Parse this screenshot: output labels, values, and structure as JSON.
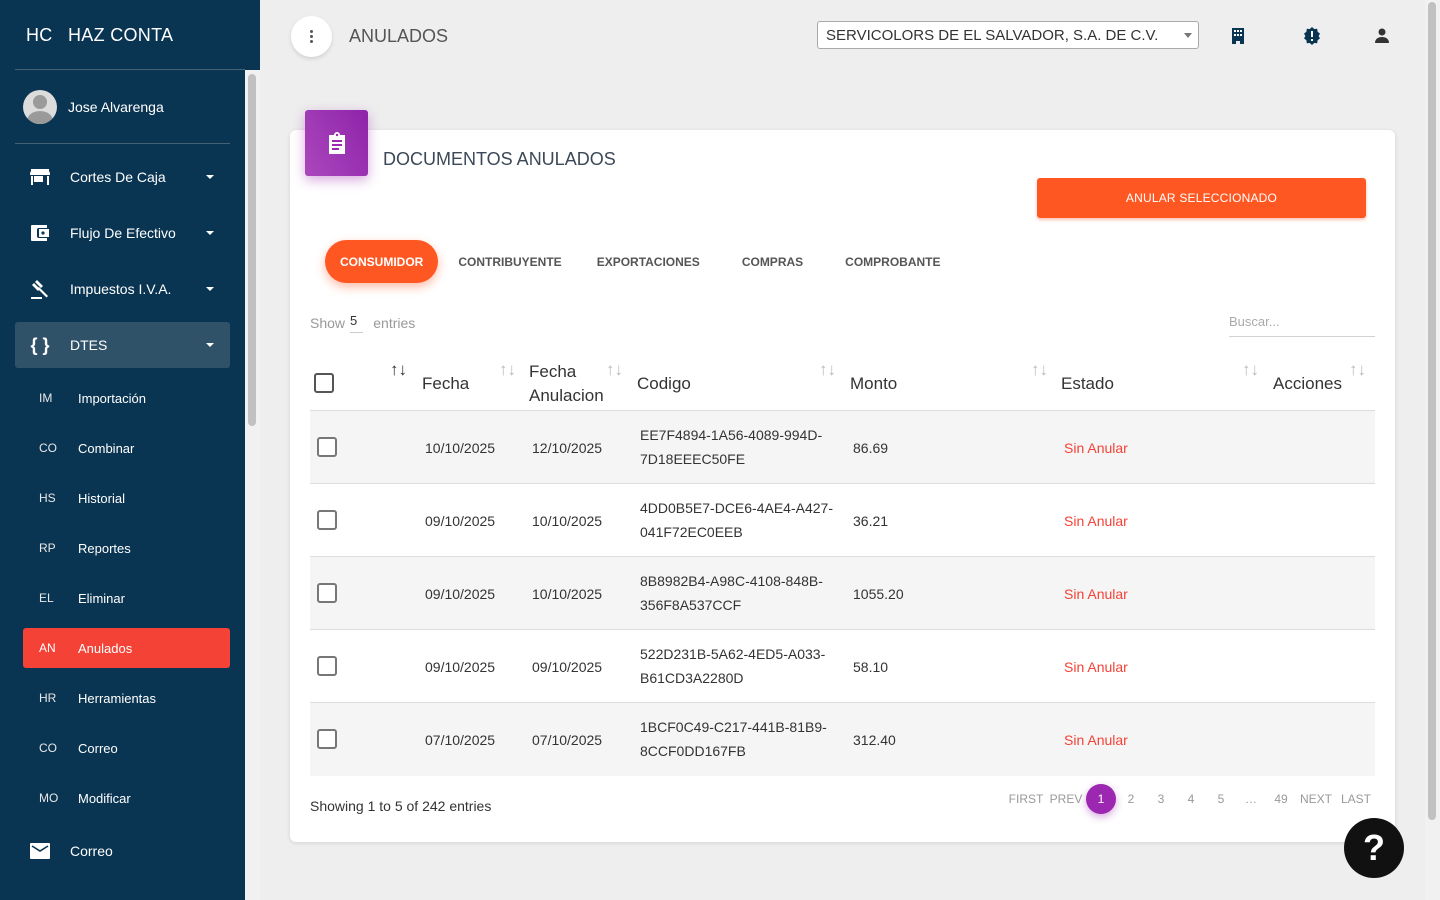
{
  "brand": {
    "mini": "HC",
    "name": "HAZ CONTA"
  },
  "user": {
    "name": "Jose Alvarenga"
  },
  "nav": [
    {
      "label": "Cortes De Caja",
      "icon": "store-icon"
    },
    {
      "label": "Flujo De Efectivo",
      "icon": "wallet-icon"
    },
    {
      "label": "Impuestos I.V.A.",
      "icon": "gavel-icon"
    },
    {
      "label": "DTES",
      "icon": "code-braces-icon"
    }
  ],
  "dtes_items": [
    {
      "abbr": "IM",
      "label": "Importación"
    },
    {
      "abbr": "CO",
      "label": "Combinar"
    },
    {
      "abbr": "HS",
      "label": "Historial"
    },
    {
      "abbr": "RP",
      "label": "Reportes"
    },
    {
      "abbr": "EL",
      "label": "Eliminar"
    },
    {
      "abbr": "AN",
      "label": "Anulados"
    },
    {
      "abbr": "HR",
      "label": "Herramientas"
    },
    {
      "abbr": "CO",
      "label": "Correo"
    },
    {
      "abbr": "MO",
      "label": "Modificar"
    }
  ],
  "nav_bottom": {
    "label": "Correo",
    "icon": "mail-icon"
  },
  "topbar": {
    "title": "ANULADOS",
    "company": "SERVICOLORS DE EL SALVADOR, S.A. DE C.V."
  },
  "card": {
    "title": "DOCUMENTOS ANULADOS",
    "action": "ANULAR SELECCIONADO",
    "tabs": [
      "CONSUMIDOR",
      "CONTRIBUYENTE",
      "EXPORTACIONES",
      "COMPRAS",
      "COMPROBANTE"
    ],
    "show_label": "Show",
    "show_value": "5",
    "entries_label": "entries",
    "search_placeholder": "Buscar...",
    "columns": [
      "Fecha",
      "Fecha",
      "Anulacion",
      "Codigo",
      "Monto",
      "Estado",
      "Acciones"
    ],
    "rows": [
      {
        "fecha": "10/10/2025",
        "anulacion": "12/10/2025",
        "codigo1": "EE7F4894-1A56-4089-994D-",
        "codigo2": "7D18EEEC50FE",
        "monto": "86.69",
        "estado": "Sin Anular"
      },
      {
        "fecha": "09/10/2025",
        "anulacion": "10/10/2025",
        "codigo1": "4DD0B5E7-DCE6-4AE4-A427-",
        "codigo2": "041F72EC0EEB",
        "monto": "36.21",
        "estado": "Sin Anular"
      },
      {
        "fecha": "09/10/2025",
        "anulacion": "10/10/2025",
        "codigo1": "8B8982B4-A98C-4108-848B-",
        "codigo2": "356F8A537CCF",
        "monto": "1055.20",
        "estado": "Sin Anular"
      },
      {
        "fecha": "09/10/2025",
        "anulacion": "09/10/2025",
        "codigo1": "522D231B-5A62-4ED5-A033-",
        "codigo2": "B61CD3A2280D",
        "monto": "58.10",
        "estado": "Sin Anular"
      },
      {
        "fecha": "07/10/2025",
        "anulacion": "07/10/2025",
        "codigo1": "1BCF0C49-C217-441B-81B9-",
        "codigo2": "8CCF0DD167FB",
        "monto": "312.40",
        "estado": "Sin Anular"
      }
    ],
    "info": "Showing 1 to 5 of 242 entries",
    "pager": [
      "FIRST",
      "PREV",
      "1",
      "2",
      "3",
      "4",
      "5",
      "…",
      "49",
      "NEXT",
      "LAST"
    ]
  },
  "help": "?",
  "colors": {
    "sidebar": "#0a3552",
    "accent": "#ff5722",
    "active_nav": "#f44336",
    "card_icon": "#9c27b0"
  }
}
